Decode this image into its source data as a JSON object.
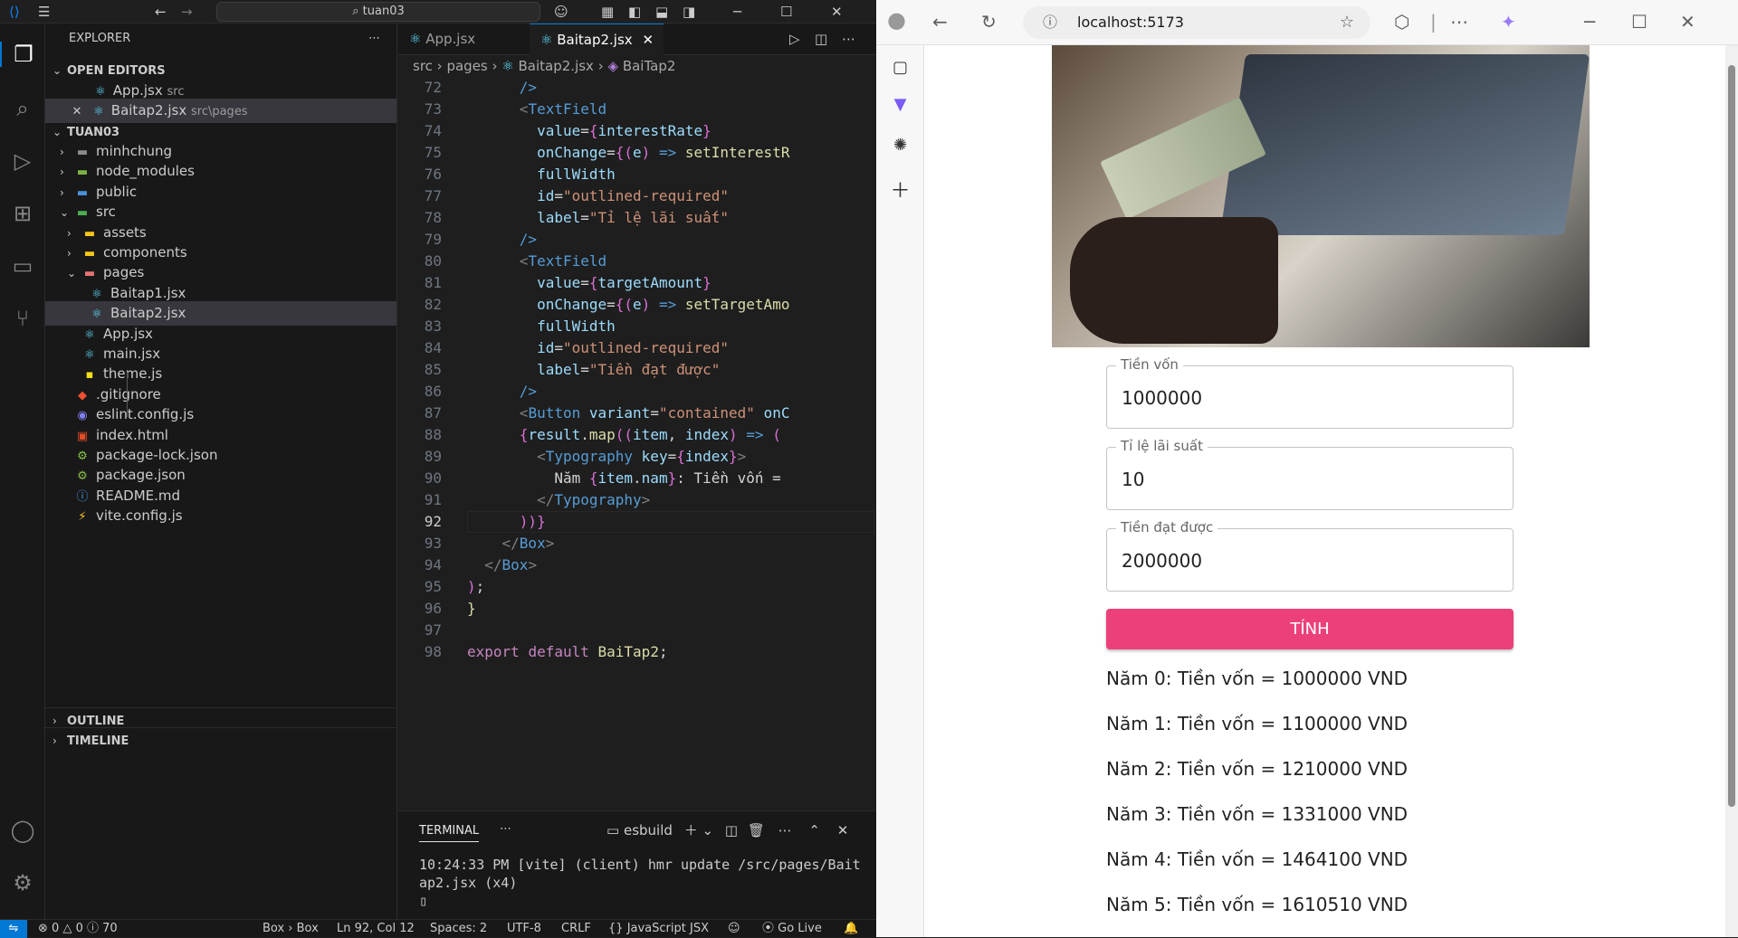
{
  "vscode": {
    "search_text": "tuan03",
    "explorer": {
      "title": "EXPLORER",
      "open_editors_label": "OPEN EDITORS",
      "open_editors": [
        {
          "name": "App.jsx",
          "path": "src"
        },
        {
          "name": "Baitap2.jsx",
          "path": "src\\pages"
        }
      ],
      "project_label": "TUAN03",
      "tree": [
        {
          "name": "minhchung",
          "icon": "folder"
        },
        {
          "name": "node_modules",
          "icon": "folder"
        },
        {
          "name": "public",
          "icon": "folder"
        },
        {
          "name": "src",
          "icon": "folder"
        },
        {
          "name": "assets",
          "icon": "folder"
        },
        {
          "name": "components",
          "icon": "folder"
        },
        {
          "name": "pages",
          "icon": "folder"
        },
        {
          "name": "Baitap1.jsx",
          "icon": "react"
        },
        {
          "name": "Baitap2.jsx",
          "icon": "react"
        },
        {
          "name": "App.jsx",
          "icon": "react"
        },
        {
          "name": "main.jsx",
          "icon": "react"
        },
        {
          "name": "theme.js",
          "icon": "js"
        },
        {
          "name": ".gitignore",
          "icon": "git"
        },
        {
          "name": "eslint.config.js",
          "icon": "eslint"
        },
        {
          "name": "index.html",
          "icon": "html"
        },
        {
          "name": "package-lock.json",
          "icon": "json"
        },
        {
          "name": "package.json",
          "icon": "json"
        },
        {
          "name": "README.md",
          "icon": "info"
        },
        {
          "name": "vite.config.js",
          "icon": "vite"
        }
      ],
      "outline_label": "OUTLINE",
      "timeline_label": "TIMELINE"
    },
    "tabs": [
      {
        "label": "App.jsx"
      },
      {
        "label": "Baitap2.jsx"
      }
    ],
    "breadcrumb": [
      "src",
      "pages",
      "Baitap2.jsx",
      "BaiTap2"
    ],
    "line_numbers": [
      "72",
      "73",
      "74",
      "75",
      "76",
      "77",
      "78",
      "79",
      "80",
      "81",
      "82",
      "83",
      "84",
      "85",
      "86",
      "87",
      "88",
      "89",
      "90",
      "91",
      "92",
      "93",
      "94",
      "95",
      "96",
      "97",
      "98"
    ],
    "terminal": {
      "tab_label": "TERMINAL",
      "shell": "esbuild",
      "line1": "10:24:33 PM [vite] (client) hmr update /src/pages/Bait",
      "line2": "ap2.jsx (x4)"
    },
    "status": {
      "errors": "0",
      "warnings": "0",
      "info": "70",
      "breadcrumb": "Box › Box",
      "position": "Ln 92, Col 12",
      "spaces": "Spaces: 2",
      "encoding": "UTF-8",
      "eol": "CRLF",
      "language": "JavaScript JSX",
      "golive": "Go Live"
    }
  },
  "browser": {
    "url": "localhost:5173",
    "fields": [
      {
        "label": "Tiền vốn",
        "value": "1000000"
      },
      {
        "label": "Tỉ lệ lãi suất",
        "value": "10"
      },
      {
        "label": "Tiền đạt được",
        "value": "2000000"
      }
    ],
    "button_label": "TÍNH",
    "results": [
      "Năm 0: Tiền vốn = 1000000 VND",
      "Năm 1: Tiền vốn = 1100000 VND",
      "Năm 2: Tiền vốn = 1210000 VND",
      "Năm 3: Tiền vốn = 1331000 VND",
      "Năm 4: Tiền vốn = 1464100 VND",
      "Năm 5: Tiền vốn = 1610510 VND"
    ],
    "accent_color": "#ec407a"
  }
}
